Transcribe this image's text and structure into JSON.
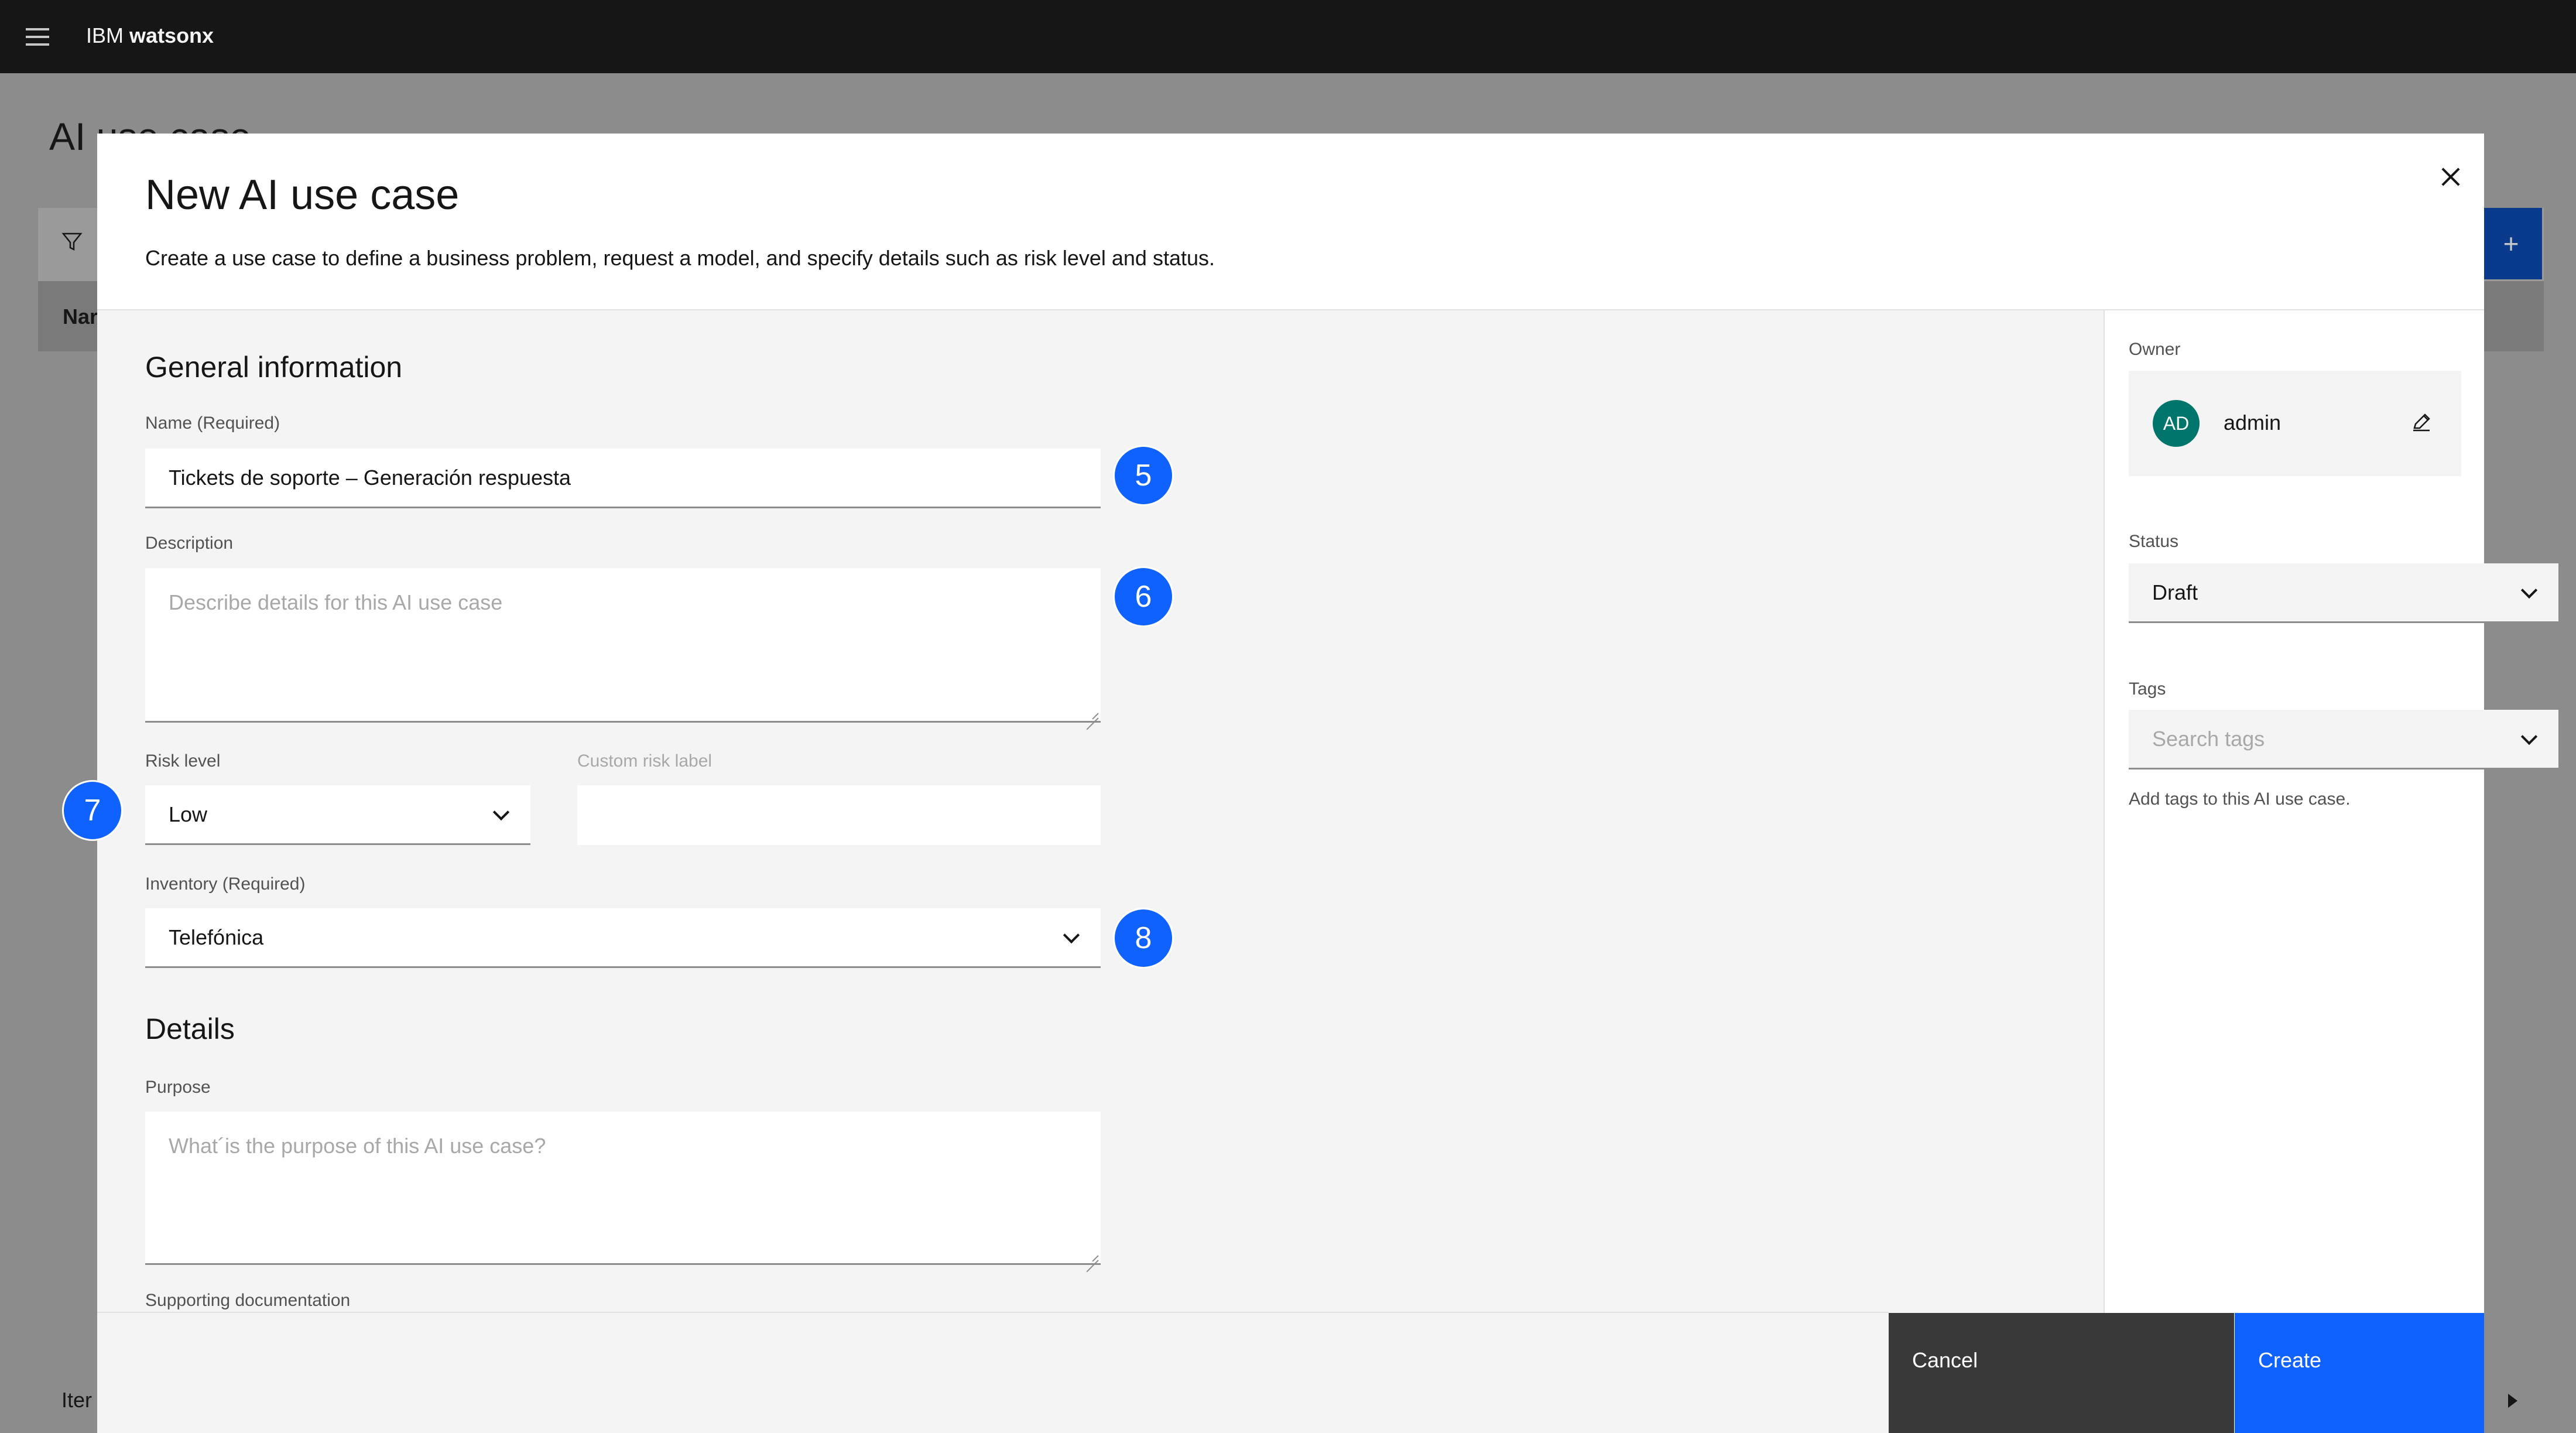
{
  "app": {
    "brand_prefix": "IBM",
    "brand_name": "watsonx"
  },
  "background_page": {
    "title": "AI use case",
    "table_header_first": "Nar",
    "add_glyph": "+",
    "footer_text": "Iter"
  },
  "modal": {
    "title": "New AI use case",
    "description": "Create a use case to define a business problem, request a model, and specify details such as risk level and status.",
    "general_info": {
      "heading": "General information",
      "name_label": "Name (Required)",
      "name_value": "Tickets de soporte – Generación respuesta",
      "description_label": "Description",
      "description_placeholder": "Describe details for this AI use case",
      "risk_label": "Risk level",
      "risk_value": "Low",
      "custom_risk_label": "Custom risk label",
      "inventory_label": "Inventory (Required)",
      "inventory_value": "Telefónica"
    },
    "details": {
      "heading": "Details",
      "purpose_label": "Purpose",
      "purpose_placeholder": "What´is the purpose of this AI use case?",
      "supporting_docs_label": "Supporting documentation"
    },
    "side": {
      "owner_label": "Owner",
      "owner_initials": "AD",
      "owner_name": "admin",
      "status_label": "Status",
      "status_value": "Draft",
      "tags_label": "Tags",
      "tags_placeholder": "Search tags",
      "tags_helper": "Add tags to this AI use case."
    },
    "buttons": {
      "cancel": "Cancel",
      "create": "Create"
    }
  },
  "callouts": [
    "5",
    "6",
    "7",
    "8"
  ],
  "colors": {
    "primary": "#0f62fe",
    "header": "#161616",
    "avatar": "#00756b",
    "cancel": "#393939"
  },
  "icons": [
    "hamburger-menu-icon",
    "filter-icon",
    "close-icon",
    "edit-icon",
    "chevron-down-icon",
    "caret-right-icon"
  ]
}
